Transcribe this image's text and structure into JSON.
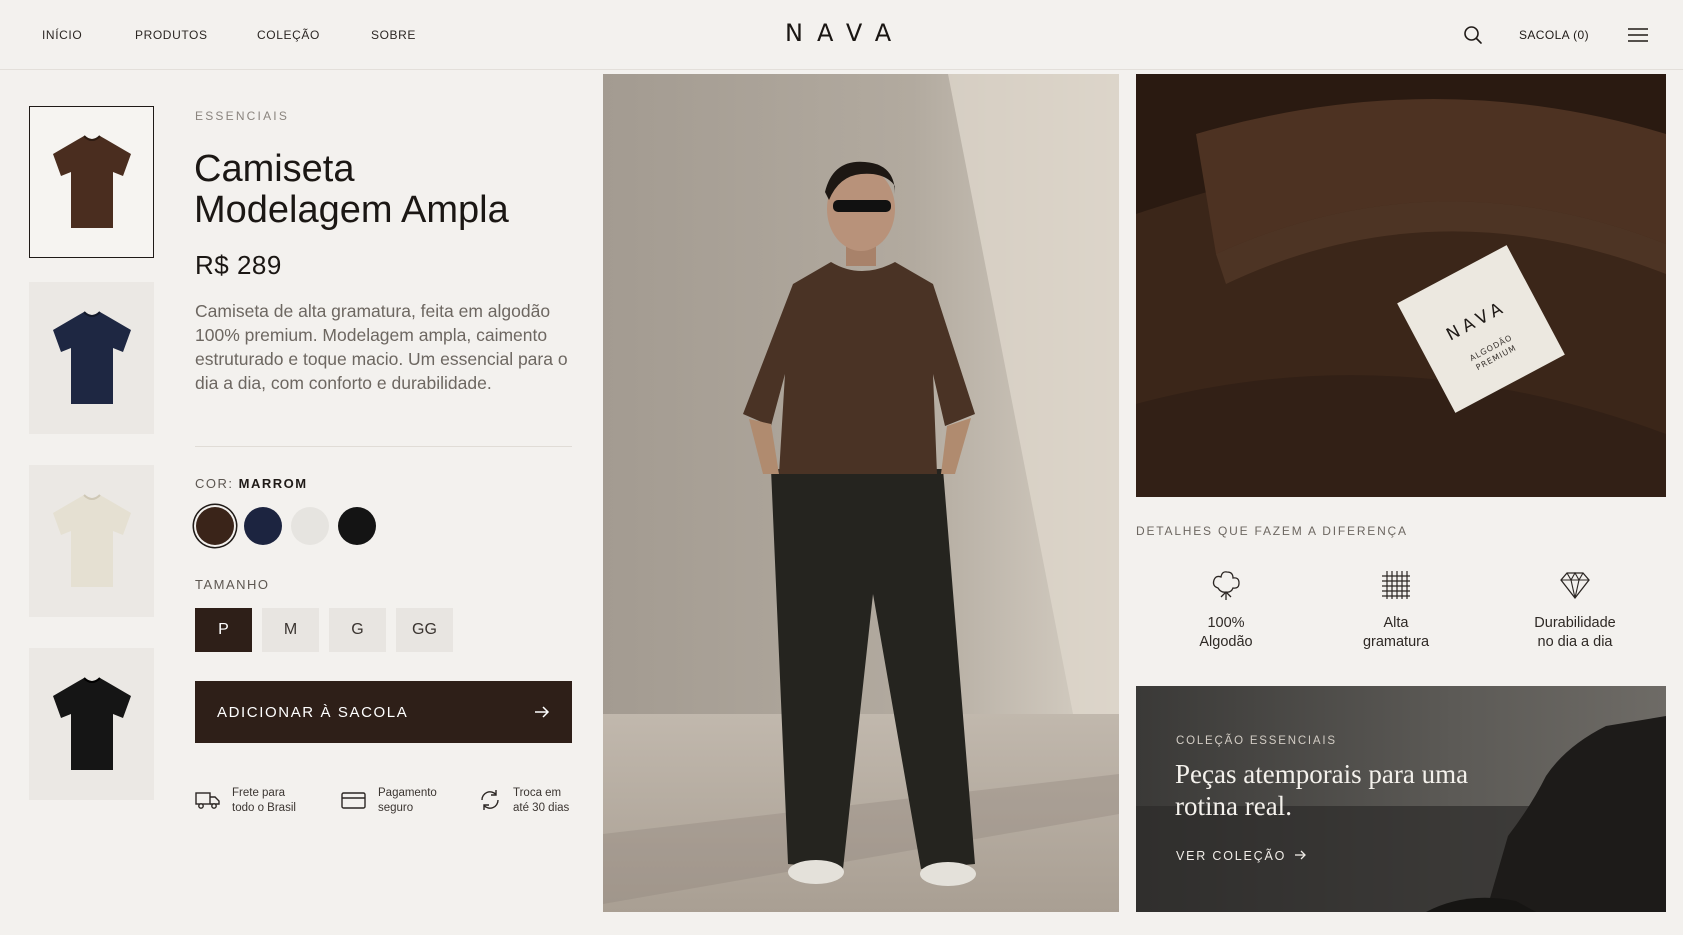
{
  "header": {
    "nav": [
      "INÍCIO",
      "PRODUTOS",
      "COLEÇÃO",
      "SOBRE"
    ],
    "logo": "NAVA",
    "search_icon": "search-icon",
    "bag_label": "SACOLA (0)",
    "menu_icon": "hamburger-menu-icon"
  },
  "thumbnails": [
    {
      "color": "#4a2d1f",
      "name": "marrom"
    },
    {
      "color": "#1e2742",
      "name": "azul-marinho"
    },
    {
      "color": "#e5e0d2",
      "name": "off-white"
    },
    {
      "color": "#151515",
      "name": "preto"
    }
  ],
  "product": {
    "category": "ESSENCIAIS",
    "title": "Camiseta Modelagem Ampla",
    "price": "R$ 289",
    "description": "Camiseta de alta gramatura, feita em algodão 100% premium. Modelagem ampla, caimento estruturado e toque macio. Um essencial para o dia a dia, com conforto e durabilidade.",
    "color_label": "COR:",
    "selected_color": "MARROM",
    "colors": [
      "#3a2419",
      "#1c2440",
      "#e6e4e0",
      "#141414"
    ],
    "size_label": "TAMANHO",
    "sizes": [
      "P",
      "M",
      "G",
      "GG"
    ],
    "selected_size": "P",
    "cta_label": "ADICIONAR À SACOLA",
    "perks": [
      {
        "icon": "truck-icon",
        "text": "Frete para\ntodo o Brasil"
      },
      {
        "icon": "credit-card-icon",
        "text": "Pagamento\nseguro"
      },
      {
        "icon": "exchange-icon",
        "text": "Troca em\naté 30 dias"
      }
    ]
  },
  "details": {
    "label_brand": "NAVA",
    "label_sub": "ALGODÃO\nPREMIUM",
    "title": "DETALHES QUE FAZEM A DIFERENÇA",
    "features": [
      {
        "icon": "cotton-icon",
        "text": "100%\nAlgodão"
      },
      {
        "icon": "grid-weave-icon",
        "text": "Alta\ngramatura"
      },
      {
        "icon": "diamond-icon",
        "text": "Durabilidade\nno dia a dia"
      }
    ]
  },
  "promo": {
    "eyebrow": "COLEÇÃO ESSENCIAIS",
    "title": "Peças atemporais para uma rotina real.",
    "link": "VER COLEÇÃO"
  },
  "colors": {
    "accent": "#2e1f18",
    "background": "#f3f1ee",
    "muted_text": "#6d6761"
  }
}
